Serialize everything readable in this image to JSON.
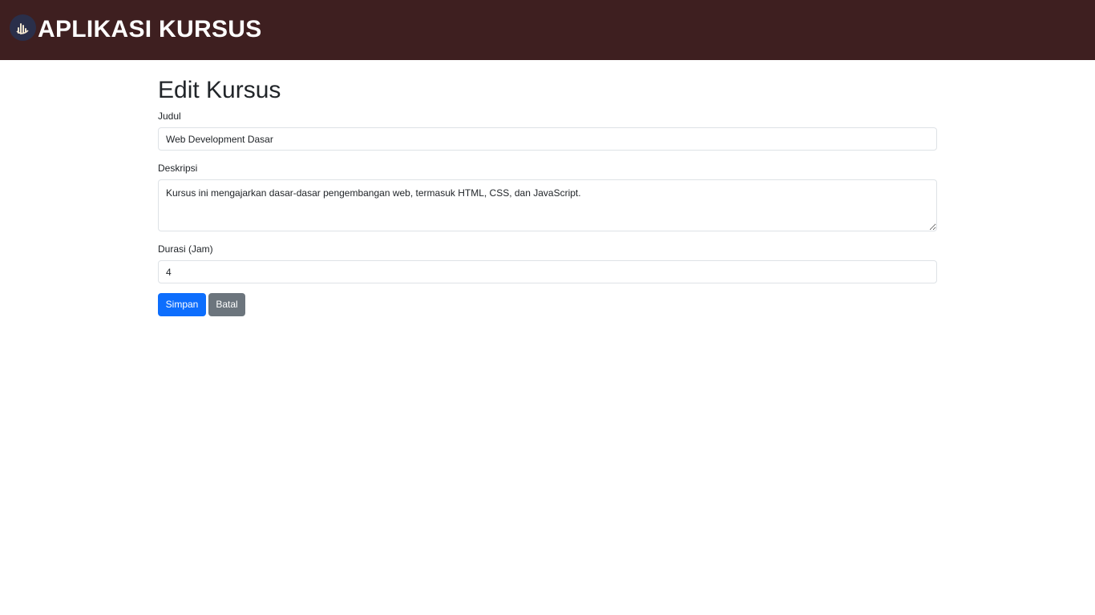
{
  "header": {
    "app_title": "APLIKASI KURSUS",
    "logo_icon": "flame-logo-icon",
    "background_color": "#3e1f20"
  },
  "form": {
    "page_title": "Edit Kursus",
    "judul": {
      "label": "Judul",
      "value": "Web Development Dasar"
    },
    "deskripsi": {
      "label": "Deskripsi",
      "value": "Kursus ini mengajarkan dasar-dasar pengembangan web, termasuk HTML, CSS, dan JavaScript."
    },
    "durasi": {
      "label": "Durasi (Jam)",
      "value": "4"
    },
    "buttons": {
      "save_label": "Simpan",
      "cancel_label": "Batal"
    }
  },
  "colors": {
    "primary": "#0d6efd",
    "secondary": "#6c757d"
  }
}
